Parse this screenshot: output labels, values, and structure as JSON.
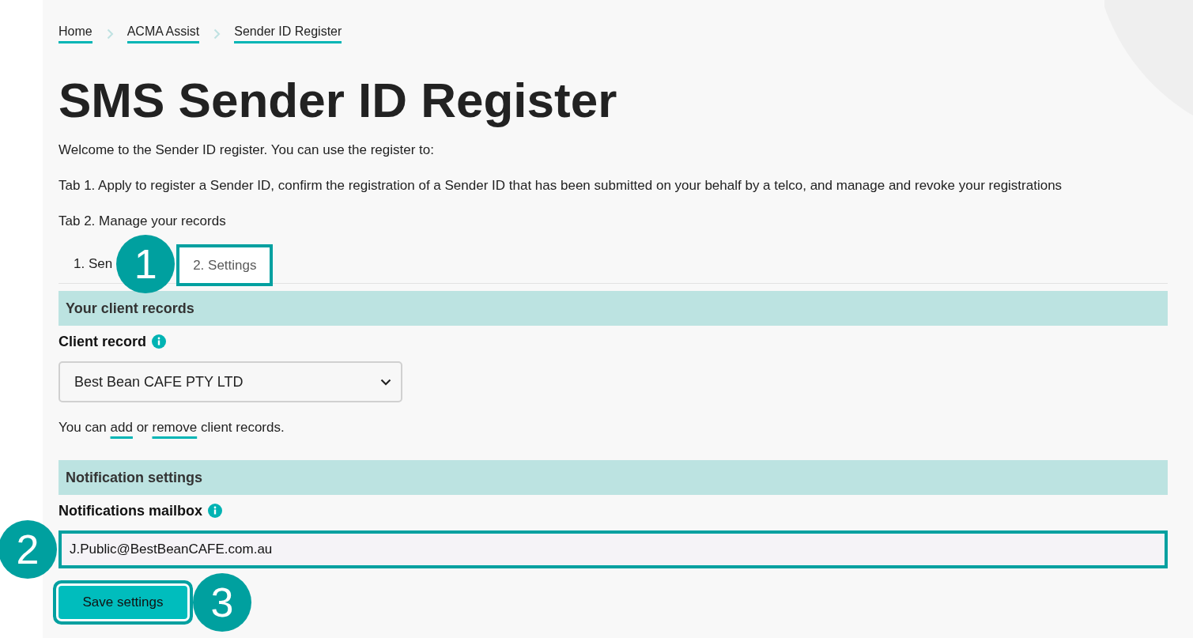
{
  "breadcrumb": [
    {
      "label": "Home"
    },
    {
      "label": "ACMA Assist"
    },
    {
      "label": "Sender ID Register"
    }
  ],
  "title": "SMS Sender ID Register",
  "intro": [
    "Welcome to the Sender ID register. You can use the register to:",
    "Tab 1. Apply to register a Sender ID, confirm the registration of a Sender ID that has been submitted on your behalf by a telco, and manage and revoke your registrations",
    "Tab 2. Manage your records"
  ],
  "tabs": [
    {
      "label": "1. Sen",
      "selected": false
    },
    {
      "label": "2. Settings",
      "selected": true,
      "callout": "1"
    }
  ],
  "sections": [
    {
      "heading": "Your client records",
      "field": {
        "kind": "select",
        "label": "Client record",
        "value": "Best Bean CAFE PTY LTD"
      },
      "note": [
        {
          "kind": "text",
          "text": "You can "
        },
        {
          "kind": "link",
          "text": "add"
        },
        {
          "kind": "text",
          "text": " or "
        },
        {
          "kind": "link",
          "text": "remove"
        },
        {
          "kind": "text",
          "text": " client records."
        }
      ]
    },
    {
      "heading": "Notification settings",
      "field": {
        "kind": "email",
        "label": "Notifications mailbox",
        "value": "J.Public@BestBeanCAFE.com.au",
        "callout": "2"
      }
    }
  ],
  "save_button": {
    "label": "Save settings",
    "callout": "3"
  }
}
